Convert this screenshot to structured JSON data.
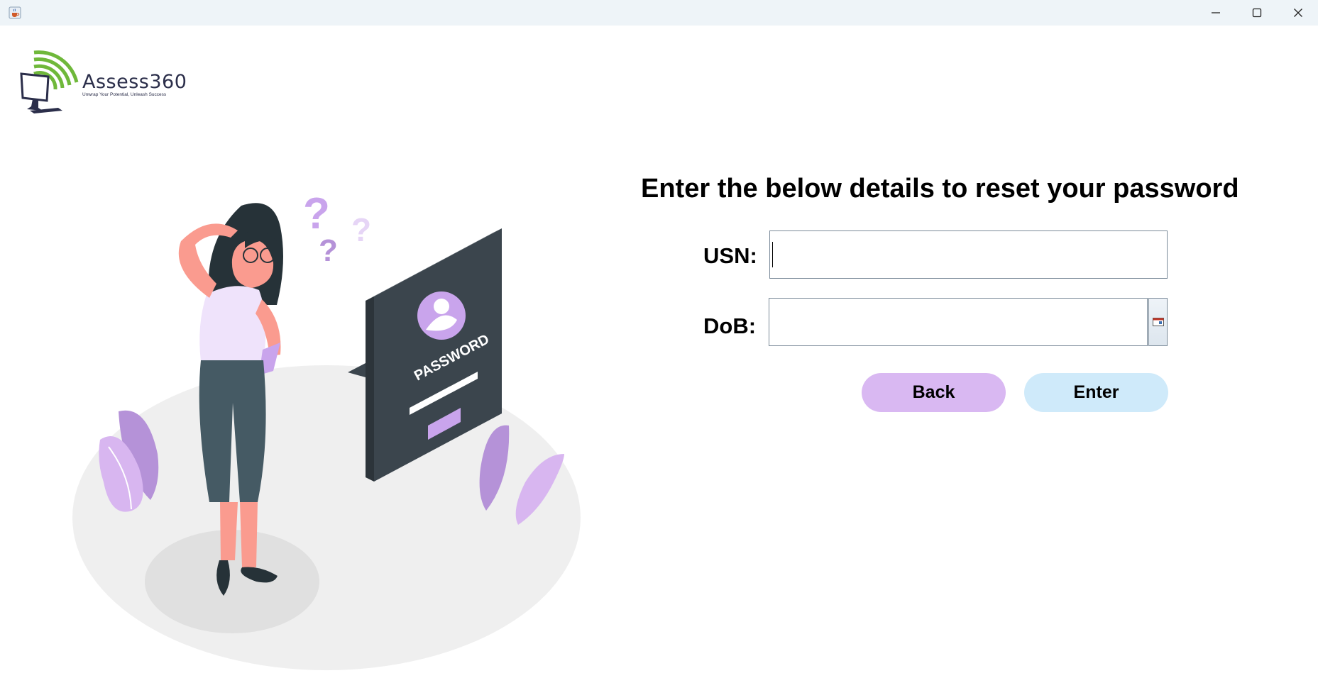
{
  "window": {
    "app_icon": "java-cup-icon",
    "controls": [
      "minimize-icon",
      "maximize-icon",
      "close-icon"
    ]
  },
  "logo": {
    "name": "Assess360",
    "tagline": "Unwrap Your Potential, Unleash Success"
  },
  "illustration": {
    "card_text": "PASSWORD"
  },
  "form": {
    "heading": "Enter the below details to reset your password",
    "usn_label": "USN:",
    "usn_value": "",
    "dob_label": "DoB:",
    "dob_value": "",
    "calendar_icon": "calendar-icon",
    "back_label": "Back",
    "enter_label": "Enter"
  },
  "colors": {
    "back_button": "#d9b8f2",
    "enter_button": "#cfeafa",
    "accent_purple": "#c9a4ec",
    "logo_green": "#6fb83a"
  }
}
